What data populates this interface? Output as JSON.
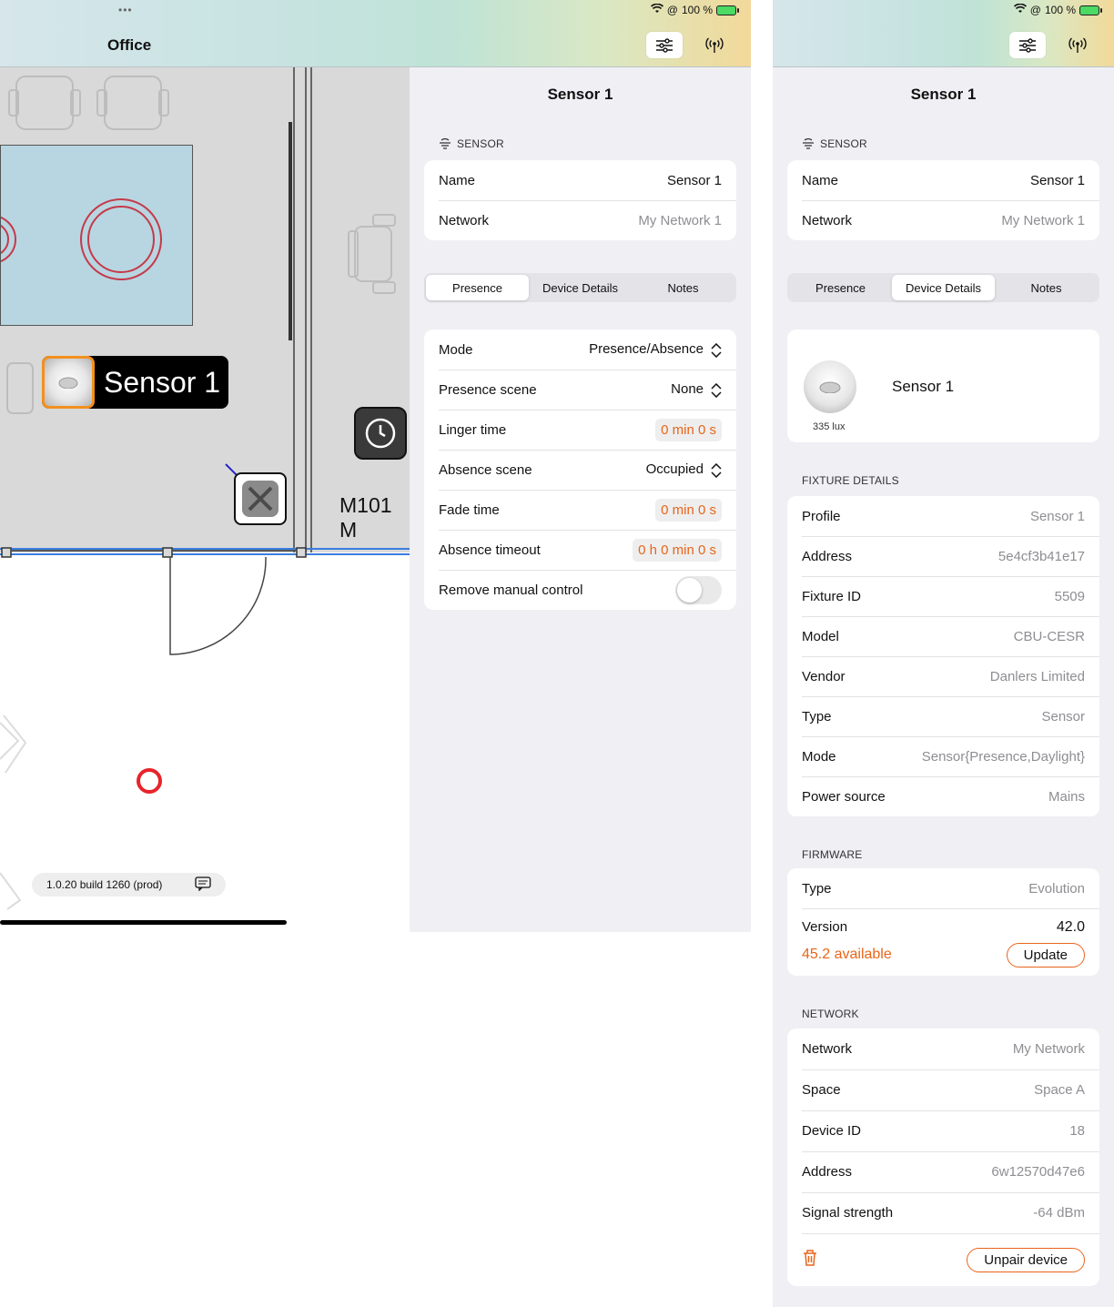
{
  "status": {
    "battery": "100 %"
  },
  "app": {
    "title": "Office"
  },
  "floorplan": {
    "sensor_label": "Sensor 1",
    "room_code": "M101 M",
    "build": "1.0.20 build 1260 (prod)"
  },
  "panel": {
    "title": "Sensor 1",
    "section_sensor": "SENSOR",
    "name_key": "Name",
    "name_val": "Sensor 1",
    "network_key": "Network",
    "network_val": "My Network 1",
    "tabs": [
      "Presence",
      "Device Details",
      "Notes"
    ]
  },
  "presence": {
    "mode_key": "Mode",
    "mode_val": "Presence/Absence",
    "scene_key": "Presence scene",
    "scene_val": "None",
    "linger_key": "Linger time",
    "linger_val": "0 min 0 s",
    "absence_scene_key": "Absence scene",
    "absence_scene_val": "Occupied",
    "fade_key": "Fade time",
    "fade_val": "0 min 0 s",
    "timeout_key": "Absence timeout",
    "timeout_val": "0 h 0 min 0 s",
    "manual_key": "Remove manual control",
    "manual_on": false
  },
  "device": {
    "name": "Sensor 1",
    "lux": "335 lux"
  },
  "fixture": {
    "label": "FIXTURE DETAILS",
    "rows": [
      {
        "k": "Profile",
        "v": "Sensor 1"
      },
      {
        "k": "Address",
        "v": "5e4cf3b41e17"
      },
      {
        "k": "Fixture ID",
        "v": "5509"
      },
      {
        "k": "Model",
        "v": "CBU-CESR"
      },
      {
        "k": "Vendor",
        "v": "Danlers Limited"
      },
      {
        "k": "Type",
        "v": "Sensor"
      },
      {
        "k": "Mode",
        "v": "Sensor{Presence,Daylight}"
      },
      {
        "k": "Power source",
        "v": "Mains"
      }
    ]
  },
  "firmware": {
    "label": "FIRMWARE",
    "type_key": "Type",
    "type_val": "Evolution",
    "version_key": "Version",
    "version_val": "42.0",
    "available": "45.2 available",
    "update_label": "Update"
  },
  "network": {
    "label": "NETWORK",
    "rows": [
      {
        "k": "Network",
        "v": "My Network"
      },
      {
        "k": "Space",
        "v": "Space A"
      },
      {
        "k": "Device ID",
        "v": "18"
      },
      {
        "k": "Address",
        "v": "6w12570d47e6"
      },
      {
        "k": "Signal strength",
        "v": "-64 dBm"
      }
    ],
    "unpair_label": "Unpair device"
  },
  "colors": {
    "accent": "#e8651a",
    "sensor_highlight": "#f3901e",
    "ring": "#e8232a"
  }
}
